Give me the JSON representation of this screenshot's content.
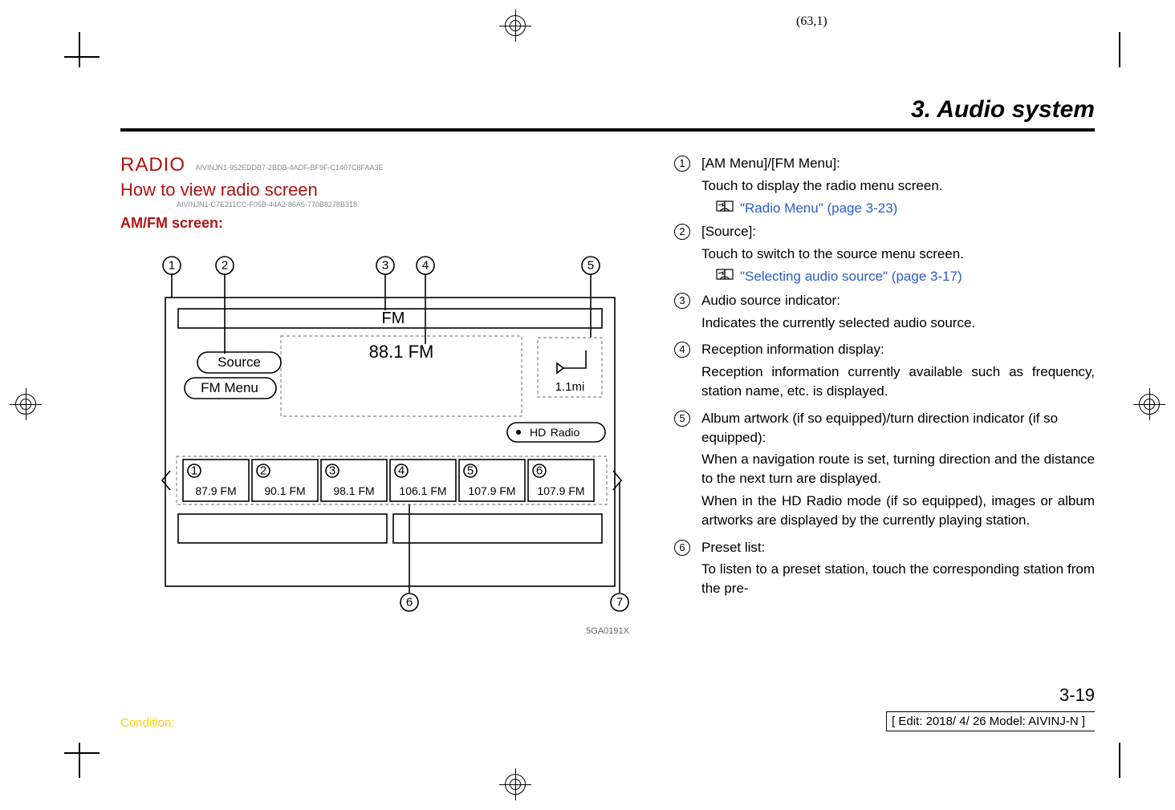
{
  "page_coord": "(63,1)",
  "section_title": "3. Audio system",
  "left": {
    "heading_radio": "RADIO",
    "hash1": "AIVINJN1-952EDDB7-2BDB-4ADF-BF9F-C1407C8FAA3E",
    "heading_howto": "How to view radio screen",
    "hash2": "AIVINJN1-C7E211CC-F05B-44A2-86A6-770B8278B318",
    "heading_amfm": "AM/FM screen:",
    "figure_id": "5GA0191X",
    "diagram": {
      "band": "FM",
      "frequency": "88.1 FM",
      "btn_source": "Source",
      "btn_menu": "FM Menu",
      "turn_distance": "1.1mi",
      "hd_radio": "HD Radio",
      "presets": [
        "87.9 FM",
        "90.1 FM",
        "98.1 FM",
        "106.1 FM",
        "107.9 FM",
        "107.9 FM"
      ],
      "callouts": [
        "1",
        "2",
        "3",
        "4",
        "5",
        "6",
        "7"
      ]
    }
  },
  "right": {
    "items": [
      {
        "num": "1",
        "title": "[AM Menu]/[FM Menu]:",
        "paras": [
          "Touch to display the radio menu screen."
        ],
        "xref": "\"Radio Menu\" (page 3-23)"
      },
      {
        "num": "2",
        "title": "[Source]:",
        "paras": [
          "Touch to switch to the source menu screen."
        ],
        "xref": "\"Selecting audio source\" (page 3-17)"
      },
      {
        "num": "3",
        "title": "Audio source indicator:",
        "paras": [
          "Indicates the currently selected audio source."
        ]
      },
      {
        "num": "4",
        "title": "Reception information display:",
        "paras": [
          "Reception information currently available such as frequency, station name, etc. is displayed."
        ]
      },
      {
        "num": "5",
        "title": "Album artwork (if so equipped)/turn direction indicator (if so equipped):",
        "paras": [
          "When a navigation route is set, turning direction and the distance to the next turn are displayed.",
          "When in the HD Radio mode (if so equipped), images or album artworks are displayed by the currently playing station."
        ]
      },
      {
        "num": "6",
        "title": "Preset list:",
        "paras": [
          "To listen to a preset station, touch the corresponding station from the pre-"
        ]
      }
    ]
  },
  "page_number": "3-19",
  "footer_left": "Condition:",
  "footer_right": "[ Edit: 2018/ 4/ 26    Model:  AIVINJ-N ]"
}
